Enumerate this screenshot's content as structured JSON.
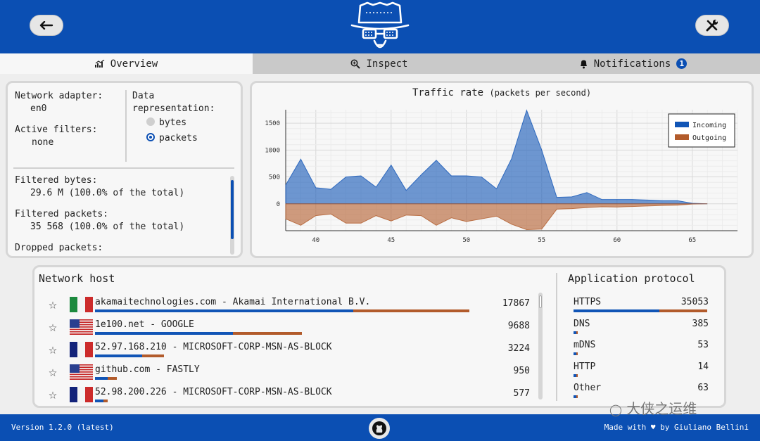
{
  "tabs": [
    {
      "label": "Overview",
      "active": true
    },
    {
      "label": "Inspect",
      "active": false
    },
    {
      "label": "Notifications",
      "active": false,
      "badge": "1"
    }
  ],
  "info": {
    "adapter_label": "Network adapter:",
    "adapter_value": "en0",
    "filters_label": "Active filters:",
    "filters_value": "none",
    "representation_label": "Data representation:",
    "opt_bytes": "bytes",
    "opt_packets": "packets",
    "selected": "packets",
    "filtered_bytes_label": "Filtered bytes:",
    "filtered_bytes_value": "29.6 M (100.0% of the total)",
    "filtered_packets_label": "Filtered packets:",
    "filtered_packets_value": "35 568 (100.0% of the total)",
    "dropped_label": "Dropped packets:"
  },
  "chart_data": {
    "type": "area",
    "title": "Traffic rate",
    "subtitle": "(packets per second)",
    "x": [
      38,
      39,
      40,
      41,
      42,
      43,
      44,
      45,
      46,
      47,
      48,
      49,
      50,
      51,
      52,
      53,
      54,
      55,
      56,
      57,
      58,
      59,
      60,
      61,
      62,
      63,
      64,
      65,
      66
    ],
    "series": [
      {
        "name": "Incoming",
        "color": "#1155b6",
        "values": [
          350,
          830,
          300,
          270,
          500,
          520,
          310,
          720,
          250,
          540,
          810,
          520,
          520,
          500,
          280,
          840,
          1740,
          1000,
          120,
          130,
          210,
          80,
          80,
          80,
          70,
          60,
          60,
          10,
          0
        ]
      },
      {
        "name": "Outgoing",
        "color": "#b25b2b",
        "values": [
          -280,
          -400,
          -220,
          -190,
          -360,
          -360,
          -220,
          -320,
          -210,
          -220,
          -400,
          -260,
          -330,
          -280,
          -230,
          -380,
          -480,
          -470,
          -100,
          -90,
          -70,
          -55,
          -60,
          -50,
          -40,
          -30,
          -25,
          -5,
          0
        ]
      }
    ],
    "yticks": [
      1500,
      1000,
      500,
      0
    ],
    "xticks": [
      40,
      45,
      50,
      55,
      60,
      65
    ],
    "ylim": [
      -500,
      1750
    ],
    "xlim": [
      38,
      68
    ],
    "legend": "top-right",
    "grid": true
  },
  "hosts": {
    "title": "Network host",
    "rows": [
      {
        "name": "akamaitechnologies.com - Akamai International B.V.",
        "value": "17867",
        "flag": "it",
        "in": 0.6,
        "out": 0.87
      },
      {
        "name": "1e100.net - GOOGLE",
        "value": "9688",
        "flag": "us",
        "in": 0.32,
        "out": 0.48
      },
      {
        "name": "52.97.168.210 - MICROSOFT-CORP-MSN-AS-BLOCK",
        "value": "3224",
        "flag": "fr",
        "in": 0.11,
        "out": 0.16
      },
      {
        "name": "github.com - FASTLY",
        "value": "950",
        "flag": "us",
        "in": 0.03,
        "out": 0.05
      },
      {
        "name": "52.98.200.226 - MICROSOFT-CORP-MSN-AS-BLOCK",
        "value": "577",
        "flag": "fr",
        "in": 0.02,
        "out": 0.03
      }
    ]
  },
  "protocols": {
    "title": "Application protocol",
    "rows": [
      {
        "name": "HTTPS",
        "value": "35053",
        "in": 0.64,
        "out": 1.0
      },
      {
        "name": "DNS",
        "value": "385",
        "in": 0.02,
        "out": 0.03
      },
      {
        "name": "mDNS",
        "value": "53",
        "in": 0.02,
        "out": 0.02
      },
      {
        "name": "HTTP",
        "value": "14",
        "in": 0.02,
        "out": 0.02
      },
      {
        "name": "Other",
        "value": "63",
        "in": 0.02,
        "out": 0.02
      }
    ]
  },
  "footer": {
    "version": "Version 1.2.0 (latest)",
    "made_prefix": "Made with",
    "made_suffix": "by Giuliano Bellini"
  },
  "watermark": "大侠之运维"
}
